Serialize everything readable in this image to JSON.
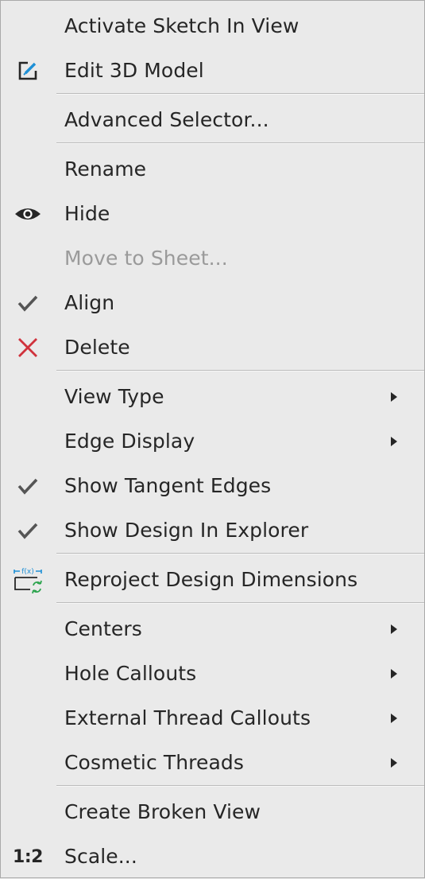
{
  "menu": {
    "items": {
      "activate_sketch": {
        "label": "Activate Sketch In View"
      },
      "edit_3d_model": {
        "label": "Edit 3D Model",
        "icon": "edit-icon"
      },
      "advanced_selector": {
        "label": "Advanced Selector..."
      },
      "rename": {
        "label": "Rename"
      },
      "hide": {
        "label": "Hide",
        "icon": "eye-icon"
      },
      "move_to_sheet": {
        "label": "Move to Sheet...",
        "disabled": true
      },
      "align": {
        "label": "Align",
        "icon": "checkmark-icon"
      },
      "delete": {
        "label": "Delete",
        "icon": "x-icon",
        "icon_color": "#d0323c"
      },
      "view_type": {
        "label": "View Type",
        "submenu": true
      },
      "edge_display": {
        "label": "Edge Display",
        "submenu": true
      },
      "show_tangent_edges": {
        "label": "Show Tangent Edges",
        "checked": true
      },
      "show_design_in_explorer": {
        "label": "Show Design In Explorer",
        "checked": true
      },
      "reproject_design_dimensions": {
        "label": "Reproject Design Dimensions",
        "icon": "reproject-dimensions-icon",
        "icon_text": "f(x)"
      },
      "centers": {
        "label": "Centers",
        "submenu": true
      },
      "hole_callouts": {
        "label": "Hole Callouts",
        "submenu": true
      },
      "external_thread_callouts": {
        "label": "External Thread Callouts",
        "submenu": true
      },
      "cosmetic_threads": {
        "label": "Cosmetic Threads",
        "submenu": true
      },
      "create_broken_view": {
        "label": "Create Broken View"
      },
      "scale": {
        "label": "Scale...",
        "icon_text": "1:2"
      }
    }
  },
  "colors": {
    "background": "#eaeaea",
    "text": "#262626",
    "disabled_text": "#9a9a9a",
    "accent_blue": "#1e90d6",
    "delete_red": "#d0323c",
    "refresh_green": "#2da44e"
  }
}
